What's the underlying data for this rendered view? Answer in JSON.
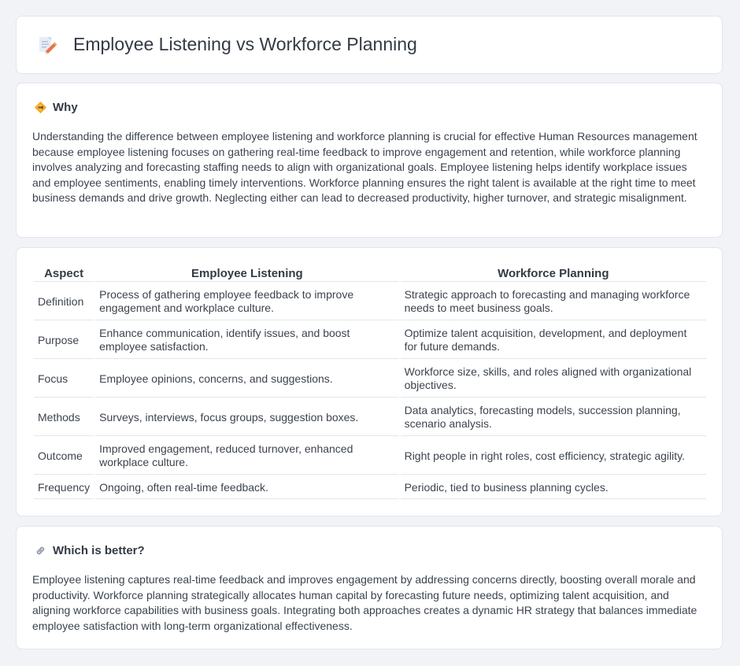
{
  "header": {
    "title": "Employee Listening vs Workforce Planning",
    "icon": "document-edit-icon"
  },
  "why": {
    "title": "Why",
    "icon": "diamond-sign-icon",
    "body": "Understanding the difference between employee listening and workforce planning is crucial for effective Human Resources management because employee listening focuses on gathering real-time feedback to improve engagement and retention, while workforce planning involves analyzing and forecasting staffing needs to align with organizational goals. Employee listening helps identify workplace issues and employee sentiments, enabling timely interventions. Workforce planning ensures the right talent is available at the right time to meet business demands and drive growth. Neglecting either can lead to decreased productivity, higher turnover, and strategic misalignment."
  },
  "comparison": {
    "headers": [
      "Aspect",
      "Employee Listening",
      "Workforce Planning"
    ],
    "rows": [
      {
        "aspect": "Definition",
        "listening": "Process of gathering employee feedback to improve engagement and workplace culture.",
        "planning": "Strategic approach to forecasting and managing workforce needs to meet business goals."
      },
      {
        "aspect": "Purpose",
        "listening": "Enhance communication, identify issues, and boost employee satisfaction.",
        "planning": "Optimize talent acquisition, development, and deployment for future demands."
      },
      {
        "aspect": "Focus",
        "listening": "Employee opinions, concerns, and suggestions.",
        "planning": "Workforce size, skills, and roles aligned with organizational objectives."
      },
      {
        "aspect": "Methods",
        "listening": "Surveys, interviews, focus groups, suggestion boxes.",
        "planning": "Data analytics, forecasting models, succession planning, scenario analysis."
      },
      {
        "aspect": "Outcome",
        "listening": "Improved engagement, reduced turnover, enhanced workplace culture.",
        "planning": "Right people in right roles, cost efficiency, strategic agility."
      },
      {
        "aspect": "Frequency",
        "listening": "Ongoing, often real-time feedback.",
        "planning": "Periodic, tied to business planning cycles."
      }
    ]
  },
  "better": {
    "title": "Which is better?",
    "icon": "link-icon",
    "body": "Employee listening captures real-time feedback and improves engagement by addressing concerns directly, boosting overall morale and productivity. Workforce planning strategically allocates human capital by forecasting future needs, optimizing talent acquisition, and aligning workforce capabilities with business goals. Integrating both approaches creates a dynamic HR strategy that balances immediate employee satisfaction with long-term organizational effectiveness."
  }
}
